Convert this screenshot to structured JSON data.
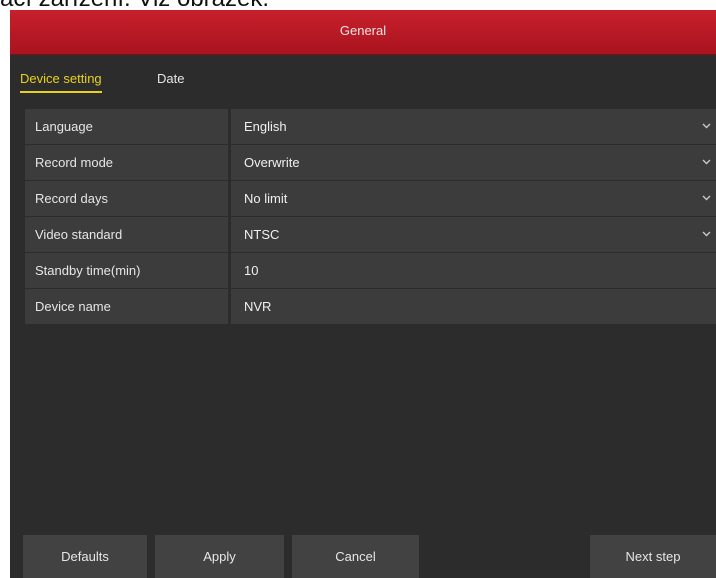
{
  "page_header": {
    "text": "ací zařízení. Viz obrázek."
  },
  "window": {
    "title": "General"
  },
  "tabs": [
    {
      "label": "Device setting",
      "active": true
    },
    {
      "label": "Date",
      "active": false
    }
  ],
  "form": {
    "rows": [
      {
        "label": "Language",
        "value": "English",
        "dropdown": true
      },
      {
        "label": "Record mode",
        "value": "Overwrite",
        "dropdown": true
      },
      {
        "label": "Record days",
        "value": "No limit",
        "dropdown": true
      },
      {
        "label": "Video standard",
        "value": "NTSC",
        "dropdown": true
      },
      {
        "label": "Standby time(min)",
        "value": "10",
        "dropdown": false
      },
      {
        "label": "Device name",
        "value": "NVR",
        "dropdown": false
      }
    ]
  },
  "footer": {
    "defaults": "Defaults",
    "apply": "Apply",
    "cancel": "Cancel",
    "next": "Next step"
  },
  "colors": {
    "titlebar": "#b81a24",
    "background": "#2c2c2c",
    "row": "#3c3c3c",
    "accent": "#e7d21c"
  },
  "icons": {
    "dropdown": "chevron-down-icon"
  }
}
